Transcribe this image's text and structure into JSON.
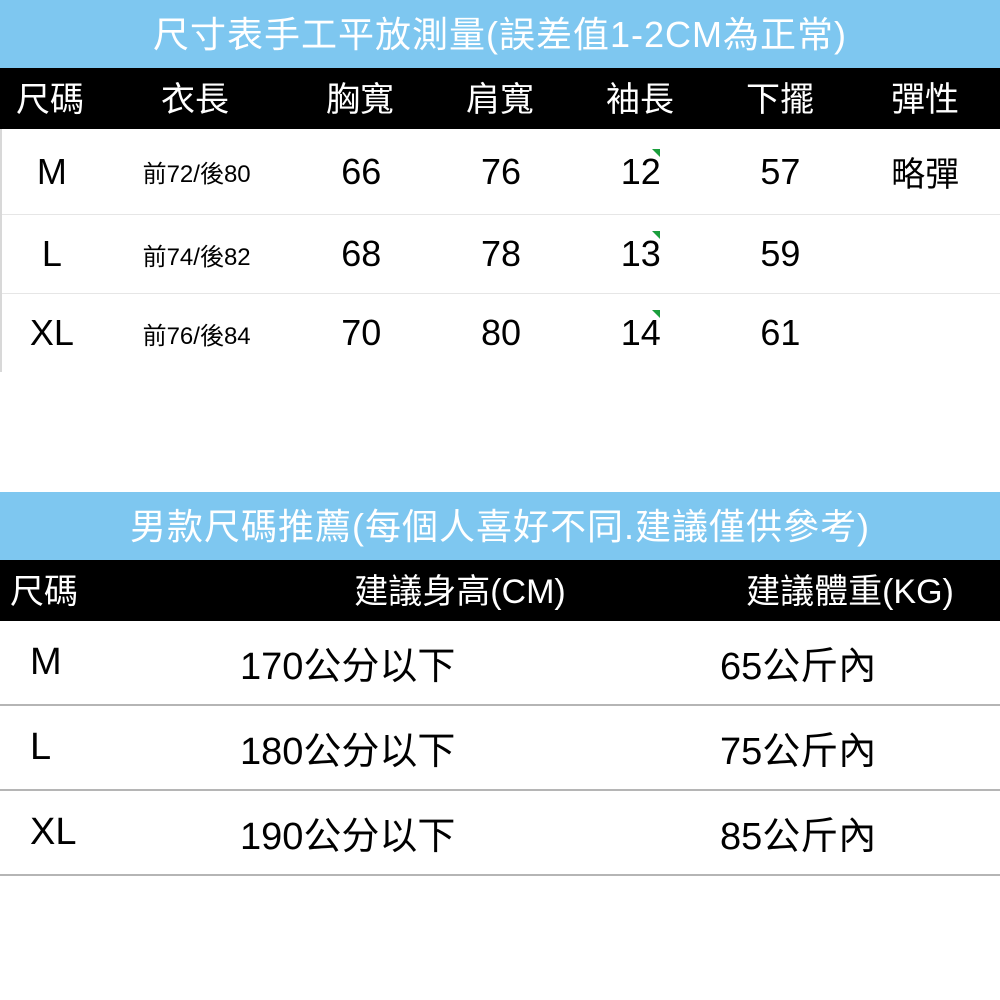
{
  "size_table": {
    "title": "尺寸表手工平放測量(誤差值1-2CM為正常)",
    "headers": [
      "尺碼",
      "衣長",
      "胸寬",
      "肩寬",
      "袖長",
      "下擺",
      "彈性"
    ],
    "rows": [
      {
        "size": "M",
        "length": "前72/後80",
        "chest": "66",
        "shoulder": "76",
        "sleeve": "12",
        "hem": "57",
        "stretch": "略彈"
      },
      {
        "size": "L",
        "length": "前74/後82",
        "chest": "68",
        "shoulder": "78",
        "sleeve": "13",
        "hem": "59",
        "stretch": ""
      },
      {
        "size": "XL",
        "length": "前76/後84",
        "chest": "70",
        "shoulder": "80",
        "sleeve": "14",
        "hem": "61",
        "stretch": ""
      }
    ]
  },
  "rec_table": {
    "title": "男款尺碼推薦(每個人喜好不同.建議僅供參考)",
    "headers": [
      "尺碼",
      "建議身高(CM)",
      "建議體重(KG)"
    ],
    "rows": [
      {
        "size": "M",
        "height": "170公分以下",
        "weight": "65公斤內"
      },
      {
        "size": "L",
        "height": "180公分以下",
        "weight": "75公斤內"
      },
      {
        "size": "XL",
        "height": "190公分以下",
        "weight": "85公斤內"
      }
    ]
  }
}
